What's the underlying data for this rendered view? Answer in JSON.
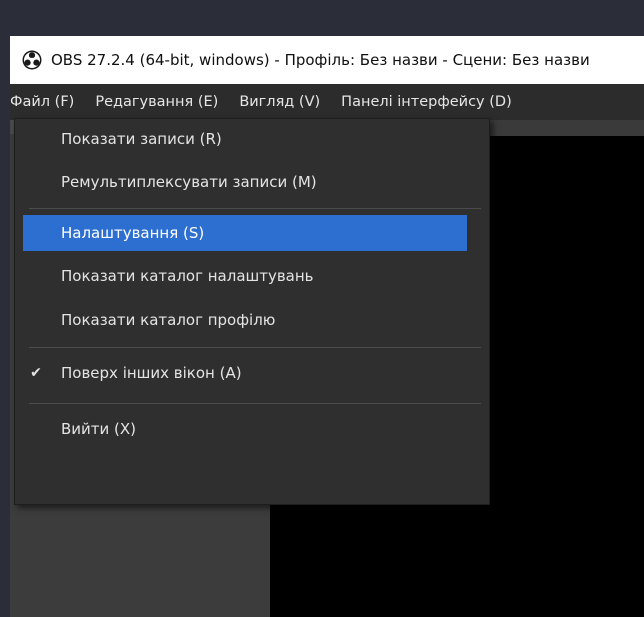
{
  "window": {
    "title": "OBS 27.2.4 (64-bit, windows) - Профіль: Без назви - Сцени: Без назви"
  },
  "menubar": {
    "items": [
      {
        "label": "Файл (F)"
      },
      {
        "label": "Редагування (E)"
      },
      {
        "label": "Вигляд (V)"
      },
      {
        "label": "Панелі інтерфейсу (D)"
      }
    ]
  },
  "file_menu": {
    "items": [
      {
        "label": "Показати записи (R)"
      },
      {
        "label": "Ремультиплексувати записи (M)"
      },
      {
        "label": "Налаштування (S)"
      },
      {
        "label": "Показати каталог налаштувань"
      },
      {
        "label": "Показати каталог профілю"
      },
      {
        "label": "Поверх інших вікон (A)",
        "checked": true
      },
      {
        "label": "Вийти (X)"
      }
    ],
    "check_glyph": "✔"
  },
  "colors": {
    "highlight": "#2d6fd0",
    "menu_bg": "#2f2f2f",
    "preview_bg": "#000000"
  },
  "icons": {
    "app_icon": "obs-logo-icon",
    "check": "check-icon"
  }
}
